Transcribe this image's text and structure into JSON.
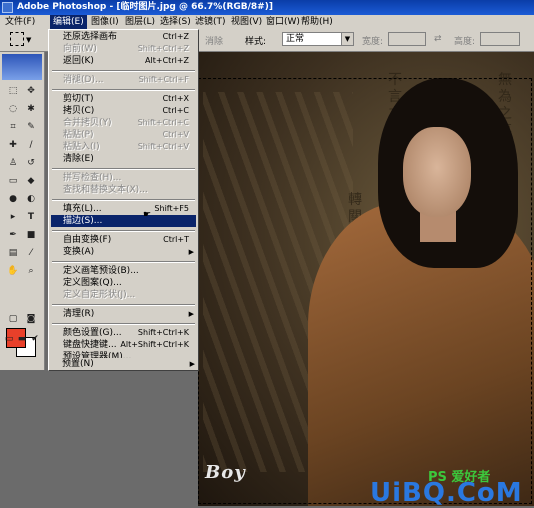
{
  "window": {
    "title": "Adobe Photoshop - [临时图片.jpg @ 66.7%(RGB/8#)]"
  },
  "menubar": [
    {
      "label": "文件(F)"
    },
    {
      "label": "编辑(E)"
    },
    {
      "label": "图像(I)"
    },
    {
      "label": "图层(L)"
    },
    {
      "label": "选择(S)"
    },
    {
      "label": "滤镜(T)"
    },
    {
      "label": "视图(V)"
    },
    {
      "label": "窗口(W)"
    },
    {
      "label": "帮助(H)"
    }
  ],
  "options": {
    "antialias_label": "消除",
    "style_label": "样式:",
    "style_value": "正常",
    "width_label": "宽度:",
    "height_label": "高度:"
  },
  "edit_menu": {
    "items": [
      {
        "label": "还原选择画布",
        "shortcut": "Ctrl+Z",
        "disabled": false
      },
      {
        "label": "向前(W)",
        "shortcut": "Shift+Ctrl+Z",
        "disabled": true
      },
      {
        "label": "返回(K)",
        "shortcut": "Alt+Ctrl+Z",
        "disabled": false
      },
      {
        "label": "消褪(D)...",
        "shortcut": "Shift+Ctrl+F",
        "disabled": true
      },
      {
        "label": "剪切(T)",
        "shortcut": "Ctrl+X",
        "disabled": false
      },
      {
        "label": "拷贝(C)",
        "shortcut": "Ctrl+C",
        "disabled": false
      },
      {
        "label": "合并拷贝(Y)",
        "shortcut": "Shift+Ctrl+C",
        "disabled": true
      },
      {
        "label": "粘贴(P)",
        "shortcut": "Ctrl+V",
        "disabled": true
      },
      {
        "label": "粘贴入(I)",
        "shortcut": "Shift+Ctrl+V",
        "disabled": true
      },
      {
        "label": "清除(E)",
        "shortcut": "",
        "disabled": false
      },
      {
        "label": "拼写检查(H)...",
        "shortcut": "",
        "disabled": true
      },
      {
        "label": "查找和替换文本(X)...",
        "shortcut": "",
        "disabled": true
      },
      {
        "label": "填充(L)...",
        "shortcut": "Shift+F5",
        "disabled": false
      },
      {
        "label": "描边(S)...",
        "shortcut": "",
        "disabled": false,
        "highlighted": true
      },
      {
        "label": "自由变换(F)",
        "shortcut": "Ctrl+T",
        "disabled": false
      },
      {
        "label": "变换(A)",
        "shortcut": "",
        "disabled": false,
        "submenu": true
      },
      {
        "label": "定义画笔预设(B)...",
        "shortcut": "",
        "disabled": false
      },
      {
        "label": "定义图案(Q)...",
        "shortcut": "",
        "disabled": false
      },
      {
        "label": "定义自定形状(J)...",
        "shortcut": "",
        "disabled": true
      },
      {
        "label": "清理(R)",
        "shortcut": "",
        "disabled": false,
        "submenu": true
      },
      {
        "label": "颜色设置(G)...",
        "shortcut": "Shift+Ctrl+K",
        "disabled": false
      },
      {
        "label": "键盘快捷键...",
        "shortcut": "Alt+Shift+Ctrl+K",
        "disabled": false
      },
      {
        "label": "预设管理器(M)...",
        "shortcut": "",
        "disabled": false
      },
      {
        "label": "预置(N)",
        "shortcut": "",
        "disabled": false,
        "submenu": true
      }
    ]
  },
  "canvas_text": {
    "boy": "Boy",
    "wm_green": "PS 爱好者",
    "wm_blue": "UiBQ.CoM",
    "brush_col1": "不言之教於",
    "brush_col2": "無為之事物",
    "brush_col3": "轉關"
  },
  "colors": {
    "foreground": "#e8402a",
    "background": "#ffffff",
    "menu_highlight": "#0a246a"
  }
}
